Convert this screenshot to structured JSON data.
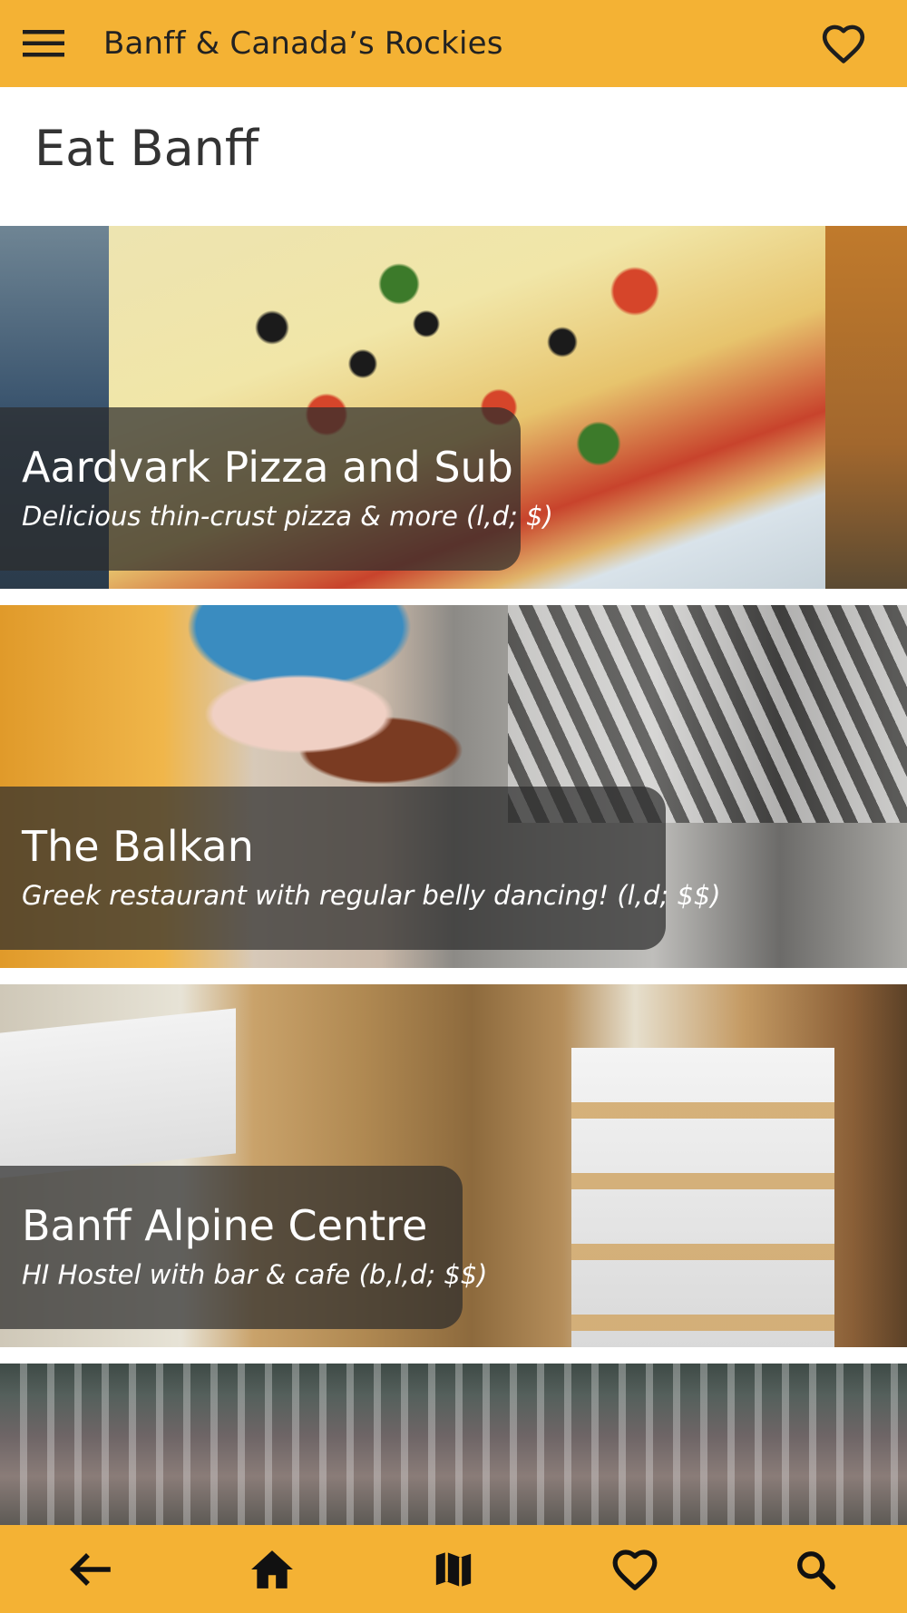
{
  "header": {
    "app_title": "Banff & Canada’s Rockies",
    "menu_icon": "hamburger-menu-icon",
    "favorite_icon": "heart-outline-icon"
  },
  "page": {
    "title": "Eat Banff"
  },
  "cards": [
    {
      "name": "Aardvark Pizza and Sub",
      "description": "Delicious thin-crust pizza & more (l,d; $)"
    },
    {
      "name": "The Balkan",
      "description": "Greek restaurant with regular belly dancing! (l,d; $$)"
    },
    {
      "name": "Banff Alpine Centre",
      "description": "HI Hostel with bar & cafe (b,l,d; $$)"
    },
    {
      "name": "",
      "description": ""
    }
  ],
  "bottom_nav": {
    "items": [
      {
        "icon": "back-arrow-icon"
      },
      {
        "icon": "home-icon"
      },
      {
        "icon": "map-icon"
      },
      {
        "icon": "favorites-heart-icon"
      },
      {
        "icon": "search-icon"
      }
    ]
  },
  "colors": {
    "accent": "#F4B234",
    "caption_background": "rgba(45,45,45,0.72)",
    "text_dark": "#222222"
  }
}
